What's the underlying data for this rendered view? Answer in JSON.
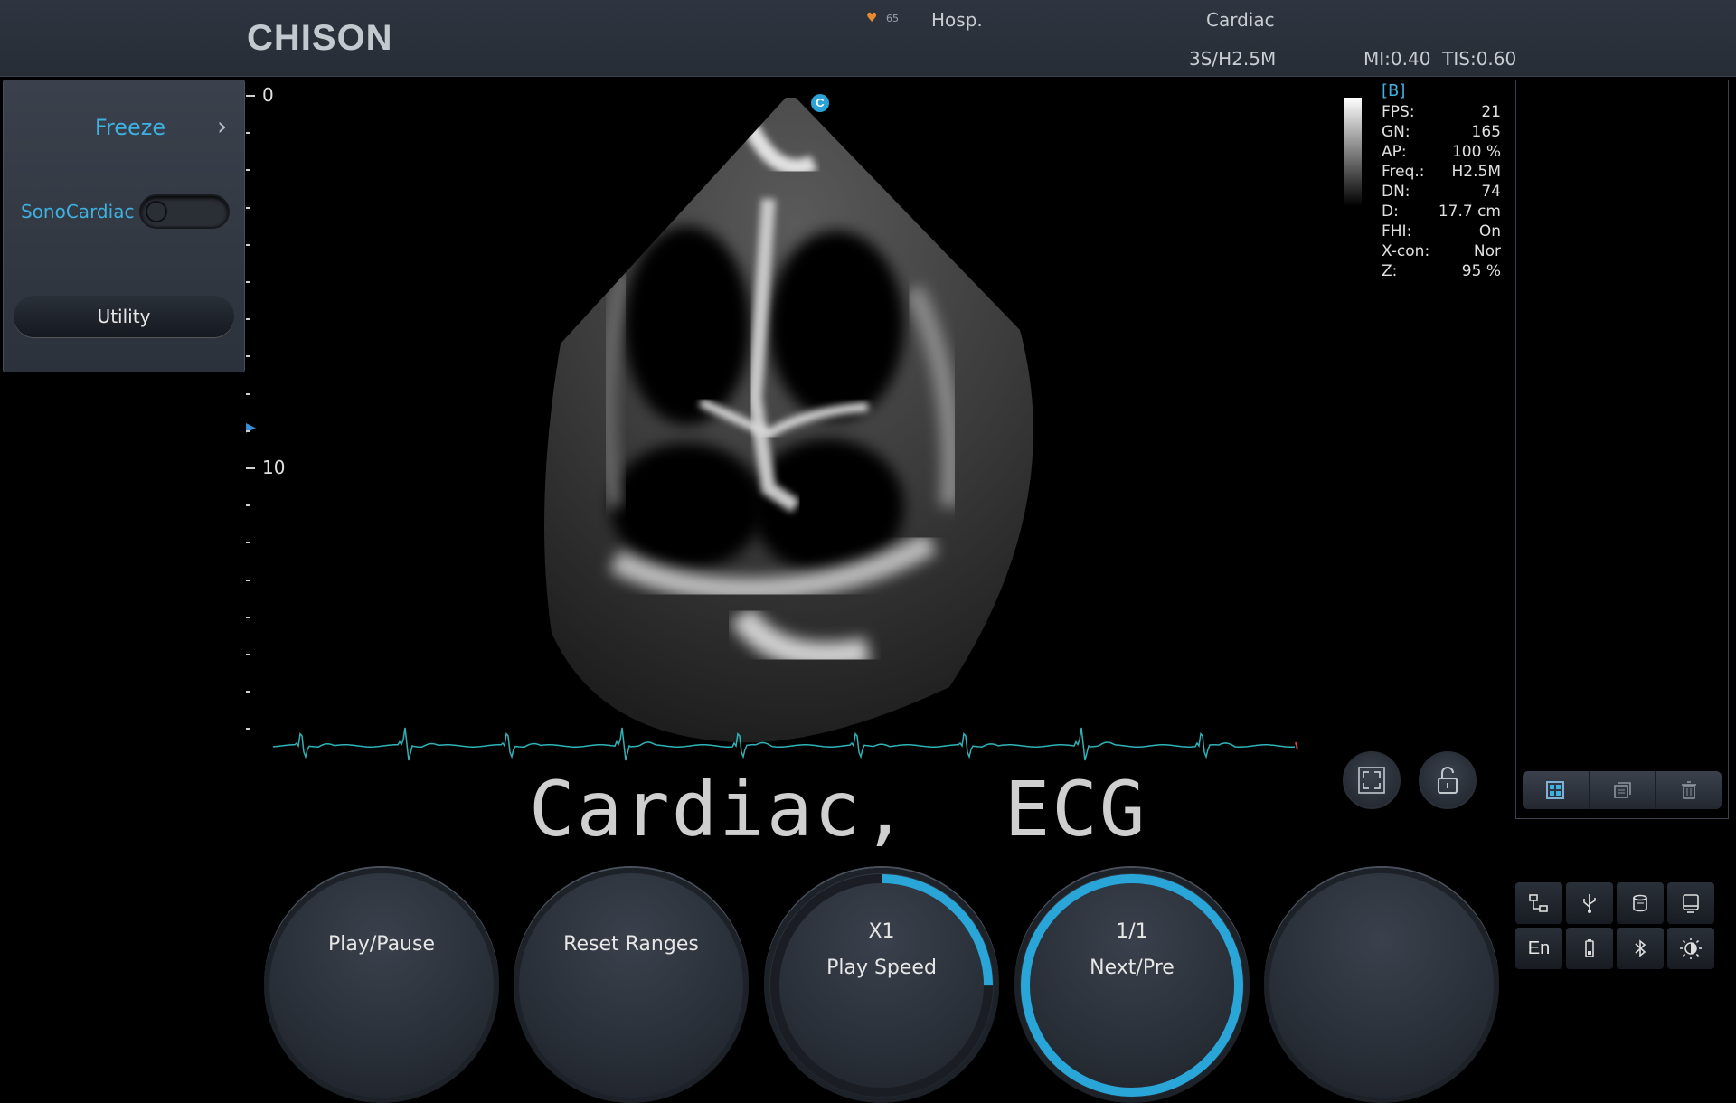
{
  "header": {
    "brand": "CHISON",
    "heart_rate": "65",
    "hospital": "Hosp.",
    "exam_preset": "Cardiac",
    "probe": "3S/H2.5M",
    "mi_tis": "MI:0.40  TIS:0.60"
  },
  "left_panel": {
    "freeze_label": "Freeze",
    "sonocardiac_label": "SonoCardiac",
    "sonocardiac_on": false,
    "utility_label": "Utility"
  },
  "depth_scale": {
    "labels": [
      "0",
      "10"
    ],
    "unit": "cm"
  },
  "probe_marker": "C",
  "parameters": {
    "mode": "[B]",
    "rows": [
      {
        "key": "FPS:",
        "value": "21"
      },
      {
        "key": "GN:",
        "value": "165"
      },
      {
        "key": "AP:",
        "value": "100 %"
      },
      {
        "key": "Freq.:",
        "value": "H2.5M"
      },
      {
        "key": "DN:",
        "value": "74"
      },
      {
        "key": "D:",
        "value": "17.7 cm"
      },
      {
        "key": "FHI:",
        "value": "On"
      },
      {
        "key": "X-con:",
        "value": "Nor"
      },
      {
        "key": "Z:",
        "value": "95 %"
      }
    ]
  },
  "caption": "Cardiac,  ECG",
  "knobs": {
    "play_pause": "Play/Pause",
    "reset_ranges": "Reset Ranges",
    "play_speed_value": "X1",
    "play_speed_label": "Play Speed",
    "play_speed_progress": 0.25,
    "next_pre_value": "1/1",
    "next_pre_label": "Next/Pre",
    "next_pre_progress": 1.0
  },
  "system": {
    "language": "En"
  },
  "colors": {
    "accent": "#3fb1e0",
    "ecg": "#2fb3b8",
    "header_bg": "#2b313a"
  },
  "icons": {
    "view": [
      "fullscreen-icon",
      "unlock-icon"
    ],
    "thumbnails": [
      "select-all-icon",
      "send-icon",
      "delete-icon"
    ],
    "system": [
      "network-icon",
      "usb-icon",
      "print-icon",
      "display-icon",
      "language-icon",
      "battery-icon",
      "bluetooth-icon",
      "brightness-icon"
    ]
  }
}
